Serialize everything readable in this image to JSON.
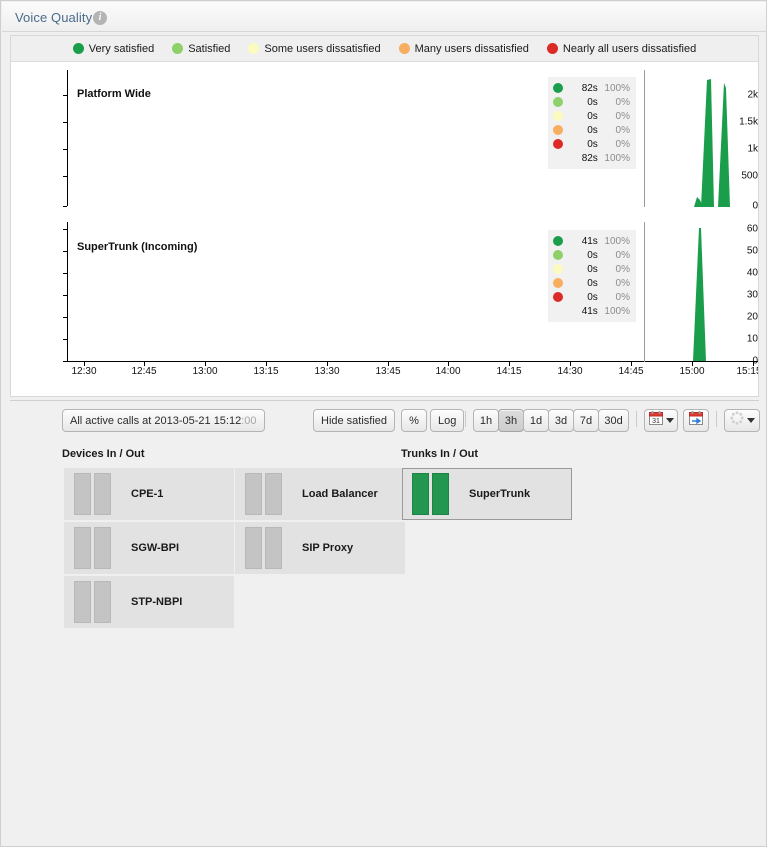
{
  "header": {
    "title": "Voice Quality",
    "info_icon": "info-icon",
    "info_glyph": "i"
  },
  "legend": {
    "items": [
      {
        "label": "Very satisfied",
        "color": "#1b9e4b"
      },
      {
        "label": "Satisfied",
        "color": "#8ed16b"
      },
      {
        "label": "Some users dissatisfied",
        "color": "#fbfbc0"
      },
      {
        "label": "Many users dissatisfied",
        "color": "#f7ae5e"
      },
      {
        "label": "Nearly all users dissatisfied",
        "color": "#dc2b26"
      }
    ]
  },
  "chart_data": [
    {
      "type": "area",
      "title": "Platform Wide",
      "xlabel": "",
      "ylabel": "",
      "ylim": [
        0,
        2200
      ],
      "yticks": [
        0,
        500,
        1000,
        1500,
        2000
      ],
      "ytick_labels": [
        "0",
        "500",
        "1k",
        "1.5k",
        "2k"
      ],
      "x": [
        "12:30",
        "12:45",
        "13:00",
        "13:15",
        "13:30",
        "13:45",
        "14:00",
        "14:15",
        "14:30",
        "14:45",
        "15:00",
        "15:15"
      ],
      "xlim": [
        "12:22",
        "15:20"
      ],
      "grid": false,
      "legend_position": "top",
      "series": [
        {
          "name": "Very satisfied",
          "color": "#1b9e4b",
          "points": [
            {
              "t": "15:13.0",
              "v": 0
            },
            {
              "t": "15:13.3",
              "v": 120
            },
            {
              "t": "15:13.6",
              "v": 90
            },
            {
              "t": "15:13.9",
              "v": 2150
            },
            {
              "t": "15:14.1",
              "v": 2120
            },
            {
              "t": "15:14.3",
              "v": 60
            },
            {
              "t": "15:14.5",
              "v": 2080
            },
            {
              "t": "15:15.0",
              "v": 40
            },
            {
              "t": "15:15.4",
              "v": 0
            }
          ]
        }
      ],
      "cursor_time": "15:12:00",
      "stat_box": {
        "rows": [
          {
            "color": "#1b9e4b",
            "value": "82s",
            "percent": "100%"
          },
          {
            "color": "#8ed16b",
            "value": "0s",
            "percent": "0%"
          },
          {
            "color": "#fbfbc0",
            "value": "0s",
            "percent": "0%"
          },
          {
            "color": "#f7ae5e",
            "value": "0s",
            "percent": "0%"
          },
          {
            "color": "#dc2b26",
            "value": "0s",
            "percent": "0%"
          }
        ],
        "total": {
          "value": "82s",
          "percent": "100%"
        }
      }
    },
    {
      "type": "area",
      "title": "SuperTrunk (Incoming)",
      "xlabel": "",
      "ylabel": "",
      "ylim": [
        0,
        60
      ],
      "yticks": [
        0,
        10,
        20,
        30,
        40,
        50,
        60
      ],
      "ytick_labels": [
        "0",
        "10",
        "20",
        "30",
        "40",
        "50",
        "60"
      ],
      "x": [
        "12:30",
        "12:45",
        "13:00",
        "13:15",
        "13:30",
        "13:45",
        "14:00",
        "14:15",
        "14:30",
        "14:45",
        "15:00",
        "15:15"
      ],
      "xlim": [
        "12:22",
        "15:20"
      ],
      "grid": false,
      "legend_position": "top",
      "series": [
        {
          "name": "Very satisfied",
          "color": "#1b9e4b",
          "points": [
            {
              "t": "15:13.4",
              "v": 0
            },
            {
              "t": "15:13.7",
              "v": 58
            },
            {
              "t": "15:13.9",
              "v": 60
            },
            {
              "t": "15:14.2",
              "v": 20
            },
            {
              "t": "15:14.6",
              "v": 0
            }
          ]
        }
      ],
      "cursor_time": "15:12:00",
      "stat_box": {
        "rows": [
          {
            "color": "#1b9e4b",
            "value": "41s",
            "percent": "100%"
          },
          {
            "color": "#8ed16b",
            "value": "0s",
            "percent": "0%"
          },
          {
            "color": "#fbfbc0",
            "value": "0s",
            "percent": "0%"
          },
          {
            "color": "#f7ae5e",
            "value": "0s",
            "percent": "0%"
          },
          {
            "color": "#dc2b26",
            "value": "0s",
            "percent": "0%"
          }
        ],
        "total": {
          "value": "41s",
          "percent": "100%"
        }
      }
    }
  ],
  "toolbar": {
    "timestamp_prefix": "All active calls at 2013-05-21 15:12",
    "timestamp_seconds": ":00",
    "hide_satisfied_label": "Hide satisfied",
    "percent_label": "%",
    "log_label": "Log",
    "ranges": [
      {
        "label": "1h",
        "active": false
      },
      {
        "label": "3h",
        "active": true
      },
      {
        "label": "1d",
        "active": false
      },
      {
        "label": "3d",
        "active": false
      },
      {
        "label": "7d",
        "active": false
      },
      {
        "label": "30d",
        "active": false
      }
    ],
    "calendar_icon": "calendar-31-icon",
    "calendar_day": "31",
    "calendar_export_icon": "calendar-export-icon",
    "spinner_icon": "loading-spinner-icon"
  },
  "devices": {
    "section_label": "Devices In / Out",
    "items": [
      {
        "name": "CPE-1",
        "state": "idle"
      },
      {
        "name": "Load Balancer",
        "state": "idle"
      },
      {
        "name": "SGW-BPI",
        "state": "idle"
      },
      {
        "name": "SIP Proxy",
        "state": "idle"
      },
      {
        "name": "STP-NBPI",
        "state": "idle"
      }
    ]
  },
  "trunks": {
    "section_label": "Trunks In / Out",
    "items": [
      {
        "name": "SuperTrunk",
        "state": "active",
        "selected": true
      }
    ]
  },
  "colors": {
    "accent_green": "#23974f",
    "panel_bg": "#f0f0f0",
    "title_blue": "#4a6b8a"
  }
}
